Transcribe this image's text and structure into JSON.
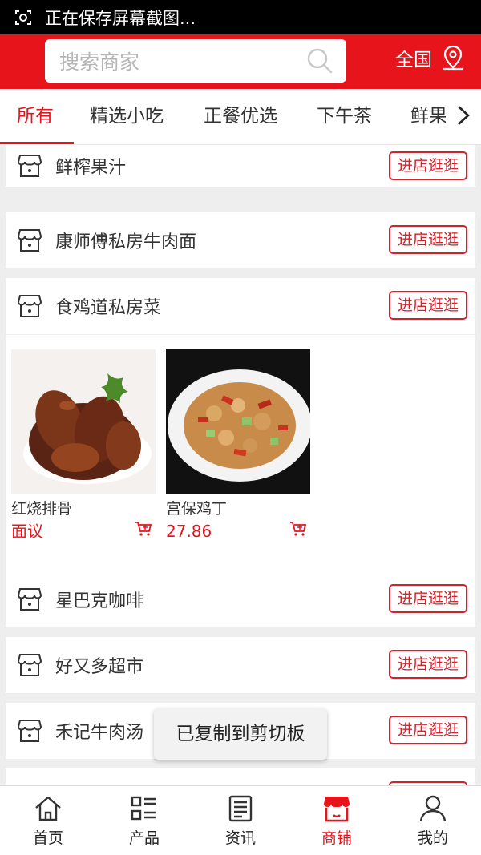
{
  "status_bar": {
    "text": "正在保存屏幕截图...",
    "icon": "screenshot-icon"
  },
  "header": {
    "search_placeholder": "搜索商家",
    "region_label": "全国",
    "brand_color": "#e8141c"
  },
  "tabs": [
    {
      "label": "所有"
    },
    {
      "label": "精选小吃"
    },
    {
      "label": "正餐优选"
    },
    {
      "label": "下午茶"
    },
    {
      "label": "鲜果"
    }
  ],
  "shops": [
    {
      "name": "鲜榨果汁",
      "button": "进店逛逛"
    },
    {
      "name": "康师傅私房牛肉面",
      "button": "进店逛逛"
    },
    {
      "name": "食鸡道私房菜",
      "button": "进店逛逛",
      "products": [
        {
          "name": "红烧排骨",
          "price": "面议"
        },
        {
          "name": "宫保鸡丁",
          "price": "27.86"
        }
      ]
    },
    {
      "name": "星巴克咖啡",
      "button": "进店逛逛"
    },
    {
      "name": "好又多超市",
      "button": "进店逛逛"
    },
    {
      "name": "禾记牛肉汤",
      "button": "进店逛逛"
    },
    {
      "name": "",
      "button": ""
    }
  ],
  "toast": "已复制到剪切板",
  "bottom_nav": [
    {
      "label": "首页",
      "icon": "home-icon"
    },
    {
      "label": "产品",
      "icon": "product-list-icon"
    },
    {
      "label": "资讯",
      "icon": "news-icon"
    },
    {
      "label": "商铺",
      "icon": "store-icon"
    },
    {
      "label": "我的",
      "icon": "user-icon"
    }
  ]
}
